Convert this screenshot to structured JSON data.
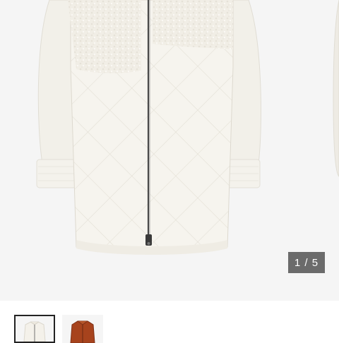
{
  "gallery": {
    "main_image": {
      "icon": "white-quilted-sherpa-jacket-image",
      "background": "#f5f5f5"
    },
    "counter": {
      "current": "1",
      "separator": "/",
      "total": "5"
    }
  },
  "thumbnails": [
    {
      "icon": "white-jacket-thumbnail",
      "selected": true,
      "color": "#f4f1ea"
    },
    {
      "icon": "rust-jacket-thumbnail",
      "selected": false,
      "color": "#a7431d"
    }
  ],
  "colors": {
    "jacket": "#f4f1ea",
    "counter_bg": "#6b6b6b",
    "active_border": "#222222",
    "rust": "#a7431d"
  }
}
